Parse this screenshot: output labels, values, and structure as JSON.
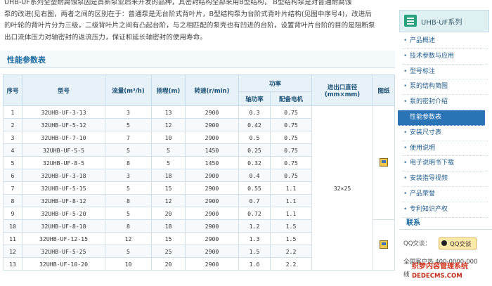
{
  "intro": {
    "line1": "  UHB-UF系列全塑耐腐蚀泵因是首新泵业后来开发的品种，其密封结构全部采用B型结构，  B型结构泵是对普通耐腐蚀",
    "line2": "泵的改进(见右图，两者之间的区别在于：普通泵是无台阶式背叶片，B型结构泵为台阶式背叶片结构(见图中序号4)，改进后",
    "line3": "的叶轮的背叶片分为三级，二级背叶片之间有凸起台阶，与之相匹配的泵壳也有凹进的台阶，设置背叶片台阶的目的是阻断泵",
    "line4": "出口流体压力对轴密封的返流压力，保证和延长轴密封的使用寿命。"
  },
  "section_title": "性能参数表",
  "table": {
    "headers": {
      "no": "序号",
      "model": "型号",
      "flow": "流量(m³/h)",
      "head": "扬程(m)",
      "speed": "转速(r/min)",
      "power": "功率",
      "shaft_power": "轴功率",
      "motor": "配备电机",
      "port": "进出口直径",
      "port_unit": "(mm×mm)",
      "figure": "图纸"
    },
    "port_value": "32×25",
    "rows": [
      {
        "no": "1",
        "model": "32UHB-UF-3-13",
        "flow": "3",
        "head": "13",
        "speed": "2900",
        "shaft": "0.3",
        "motor": "0.75"
      },
      {
        "no": "2",
        "model": "32UHB-UF-5-12",
        "flow": "5",
        "head": "12",
        "speed": "2900",
        "shaft": "0.42",
        "motor": "0.75"
      },
      {
        "no": "3",
        "model": "32UHB-UF-7-10",
        "flow": "7",
        "head": "10",
        "speed": "2900",
        "shaft": "0.5",
        "motor": "0.75"
      },
      {
        "no": "4",
        "model": "32UHB-UF-5-5",
        "flow": "5",
        "head": "5",
        "speed": "1450",
        "shaft": "0.25",
        "motor": "0.75"
      },
      {
        "no": "5",
        "model": "32UHB-UF-8-5",
        "flow": "8",
        "head": "5",
        "speed": "1450",
        "shaft": "0.32",
        "motor": "0.75"
      },
      {
        "no": "6",
        "model": "32UHB-UF-3-18",
        "flow": "3",
        "head": "18",
        "speed": "2900",
        "shaft": "0.4",
        "motor": "0.75"
      },
      {
        "no": "7",
        "model": "32UHB-UF-5-15",
        "flow": "5",
        "head": "15",
        "speed": "2900",
        "shaft": "0.55",
        "motor": "1.1"
      },
      {
        "no": "8",
        "model": "32UHB-UF-8-12",
        "flow": "8",
        "head": "12",
        "speed": "2900",
        "shaft": "0.7",
        "motor": "1.1"
      },
      {
        "no": "9",
        "model": "32UHB-UF-5-20",
        "flow": "5",
        "head": "20",
        "speed": "2900",
        "shaft": "0.72",
        "motor": "1.1"
      },
      {
        "no": "10",
        "model": "32UHB-UF-8-18",
        "flow": "8",
        "head": "18",
        "speed": "2900",
        "shaft": "1.2",
        "motor": "1.5"
      },
      {
        "no": "11",
        "model": "32UHB-UF-12-15",
        "flow": "12",
        "head": "15",
        "speed": "2900",
        "shaft": "1.3",
        "motor": "1.5"
      },
      {
        "no": "12",
        "model": "32UHB-UF-5-25",
        "flow": "5",
        "head": "25",
        "speed": "2900",
        "shaft": "1.5",
        "motor": "2.2"
      },
      {
        "no": "13",
        "model": "32UHB-UF-10-20",
        "flow": "10",
        "head": "20",
        "speed": "2900",
        "shaft": "1.6",
        "motor": "2.2"
      }
    ]
  },
  "sidebar": {
    "title": "UHB-UF系列",
    "items": [
      {
        "label": "产品概述"
      },
      {
        "label": "技术参数与应用"
      },
      {
        "label": "型号标注"
      },
      {
        "label": "泵的结构简图"
      },
      {
        "label": "泵的密封介绍"
      },
      {
        "label": "性能参数表"
      },
      {
        "label": "安装尺寸表"
      },
      {
        "label": "使用说明"
      },
      {
        "label": "电子说明书下载"
      },
      {
        "label": "安装指导视频"
      },
      {
        "label": "产品荣誉"
      },
      {
        "label": "专利知识产权"
      }
    ],
    "active_index": 5,
    "contact_title": "联系",
    "qq_label": "QQ交谈：",
    "qq_button": "QQ交谈",
    "line_a": "全国客户热  400-0000-000",
    "line_b": "线"
  },
  "watermark": {
    "line1": "织梦内容管理系统",
    "line2": "DEDECMS.COM"
  }
}
